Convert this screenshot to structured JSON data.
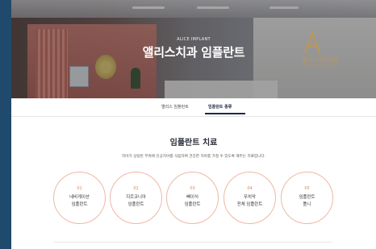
{
  "hero": {
    "eyebrow": "ALICE IMPLANT",
    "title": "앨리스치과 임플란트",
    "logo_text": "앨리스치과의원",
    "logo_sub": "ALICE DENTAL CLINIC"
  },
  "tabs": [
    {
      "label": "앨리스 임플란트",
      "active": false
    },
    {
      "label": "임플란트 종류",
      "active": true
    }
  ],
  "main": {
    "title": "임플란트 치료",
    "description": "치아가 상실된 부위에 인공치아를 식립하여 건강한 치아를 가질 수 있도록 해주는 치료입니다."
  },
  "types": [
    {
      "num": "01",
      "line1": "네비게이션",
      "line2": "임플란트"
    },
    {
      "num": "02",
      "line1": "지르코니아",
      "line2": "임플란트"
    },
    {
      "num": "03",
      "line1": "뼈이식",
      "line2": "임플란트"
    },
    {
      "num": "04",
      "line1": "무치악",
      "line2": "전체 임플란트"
    },
    {
      "num": "05",
      "line1": "임플란트",
      "line2": "틀니"
    }
  ],
  "colors": {
    "accent": "#e0846c",
    "circle_border": "#efb7a4",
    "nav_active": "#1f2a44",
    "logo_gold": "#b9985a",
    "side_bg": "#1f4a6b"
  }
}
